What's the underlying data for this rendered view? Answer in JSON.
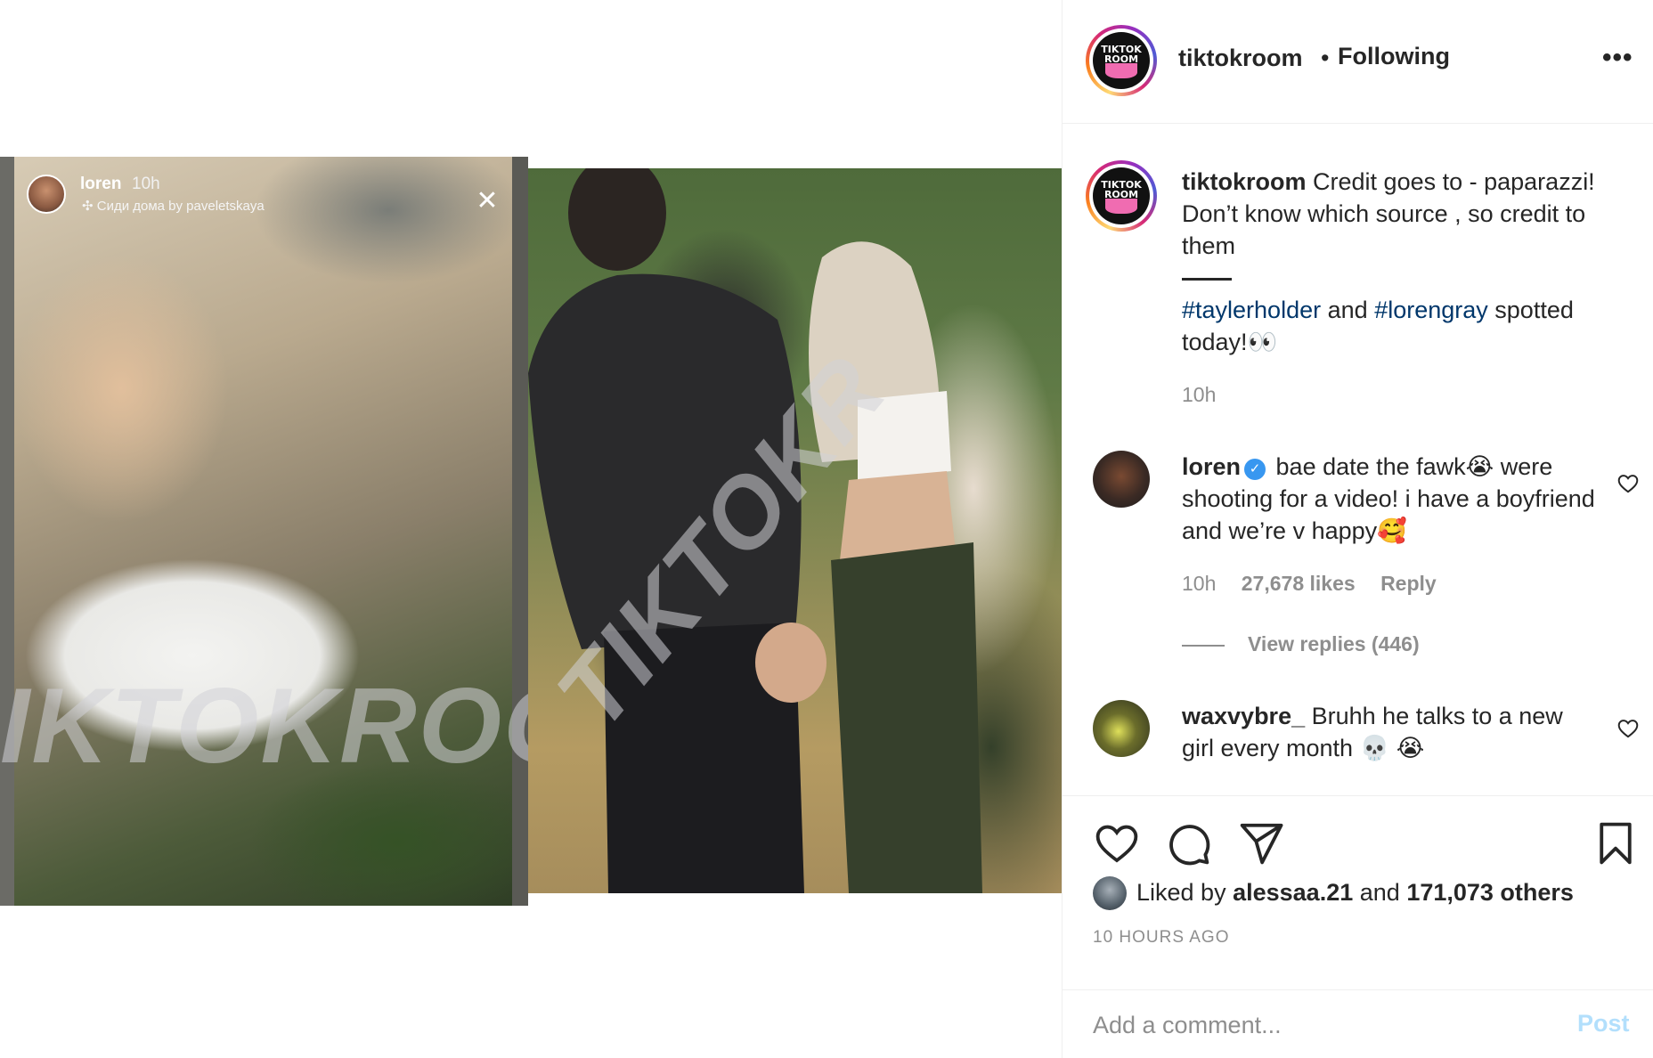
{
  "media": {
    "story": {
      "username": "loren",
      "time": "10h",
      "music": "✣ Сиди дома by paveletskaya"
    },
    "watermark": "TIKTOKROOM",
    "watermark_left": "IKTOKROO",
    "watermark_right": "TIKTOKR"
  },
  "header": {
    "avatar_text": "TIKTOK ROOM",
    "username": "tiktokroom",
    "separator": "•",
    "follow_status": "Following",
    "more": "•••"
  },
  "caption": {
    "username": "tiktokroom",
    "text": "Credit goes to - paparazzi! Don’t know which source , so credit to them",
    "hashtag1": "#taylerholder",
    "and": "and",
    "hashtag2": "#lorengray",
    "rest": "spotted today!👀",
    "time": "10h"
  },
  "comments": [
    {
      "username": "loren",
      "verified": true,
      "text": "bae date the fawk😭 were shooting for a video! i have a boyfriend and we’re v happy🥰",
      "time": "10h",
      "likes": "27,678 likes",
      "reply": "Reply",
      "view_replies": "View replies (446)"
    },
    {
      "username": "waxvybre_",
      "verified": false,
      "text": "Bruhh he talks to a new girl every month 💀 😭"
    }
  ],
  "actions": {
    "icons": [
      "heart-icon",
      "comment-icon",
      "share-icon",
      "bookmark-icon"
    ],
    "liked_by_prefix": "Liked by",
    "liked_by_user": "alessaa.21",
    "liked_by_and": "and",
    "liked_by_others": "171,073 others",
    "post_time": "10 HOURS AGO"
  },
  "add_comment": {
    "placeholder": "Add a comment...",
    "post_label": "Post"
  },
  "colors": {
    "link": "#00376b",
    "muted": "#8e8e8e",
    "verified": "#3897f0",
    "post_disabled": "#b2dffc"
  }
}
